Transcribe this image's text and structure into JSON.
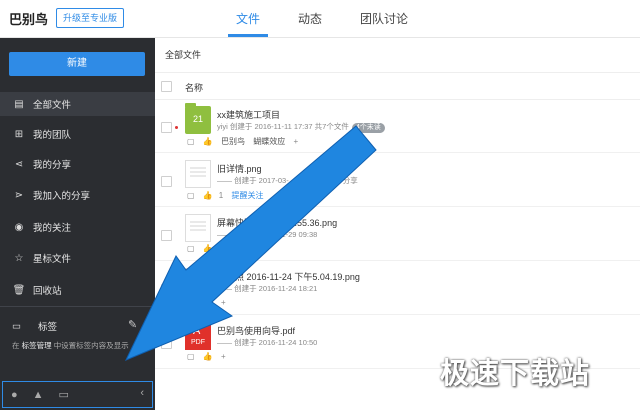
{
  "header": {
    "logo": "巴别鸟",
    "upgrade": "升级至专业版",
    "tabs": [
      "文件",
      "动态",
      "团队讨论"
    ]
  },
  "sidebar": {
    "new_button": "新建",
    "items": [
      {
        "label": "全部文件",
        "icon": "files-icon"
      },
      {
        "label": "我的团队",
        "icon": "team-icon"
      },
      {
        "label": "我的分享",
        "icon": "share-icon"
      },
      {
        "label": "我加入的分享",
        "icon": "joined-share-icon"
      },
      {
        "label": "我的关注",
        "icon": "eye-icon"
      },
      {
        "label": "星标文件",
        "icon": "star-icon"
      },
      {
        "label": "回收站",
        "icon": "trash-icon"
      }
    ],
    "tags_label": "标签",
    "tag_hint_prefix": "在",
    "tag_hint_bold": "标签管理",
    "tag_hint_suffix": "中设置标签内容及显示"
  },
  "main": {
    "breadcrumb": "全部文件",
    "column_name": "名称",
    "rows": [
      {
        "name": "xx建筑施工项目",
        "meta": "yiyi 创建于 2016-11-11 17:37  共7个文件",
        "badge": "4个未读",
        "actions": [
          "巴别鸟",
          "蝴蝶效应",
          "+"
        ]
      },
      {
        "name": "旧详情.png",
        "meta": "—— 创建于 2017-03-",
        "meta2": "分享",
        "actions": [
          "1",
          "提醒关注"
        ]
      },
      {
        "name": "屏幕快照",
        "name_suffix": "上午9.55.36.png",
        "meta": "—— 创建于 2016-11-29 09:38",
        "actions": [
          "+"
        ]
      },
      {
        "name": "照 2016-11-24 下午5.04.19.png",
        "meta": "—— 创建于 2016-11-24 18:21",
        "actions": [
          "+"
        ]
      },
      {
        "name": "巴别鸟使用向导.pdf",
        "meta": "—— 创建于 2016-11-24 10:50",
        "actions": [
          "+"
        ]
      }
    ]
  },
  "watermark": "极速下载站",
  "colors": {
    "accent": "#2f8be6",
    "sidebar": "#2b2d31",
    "arrow": "#1f86e0"
  }
}
